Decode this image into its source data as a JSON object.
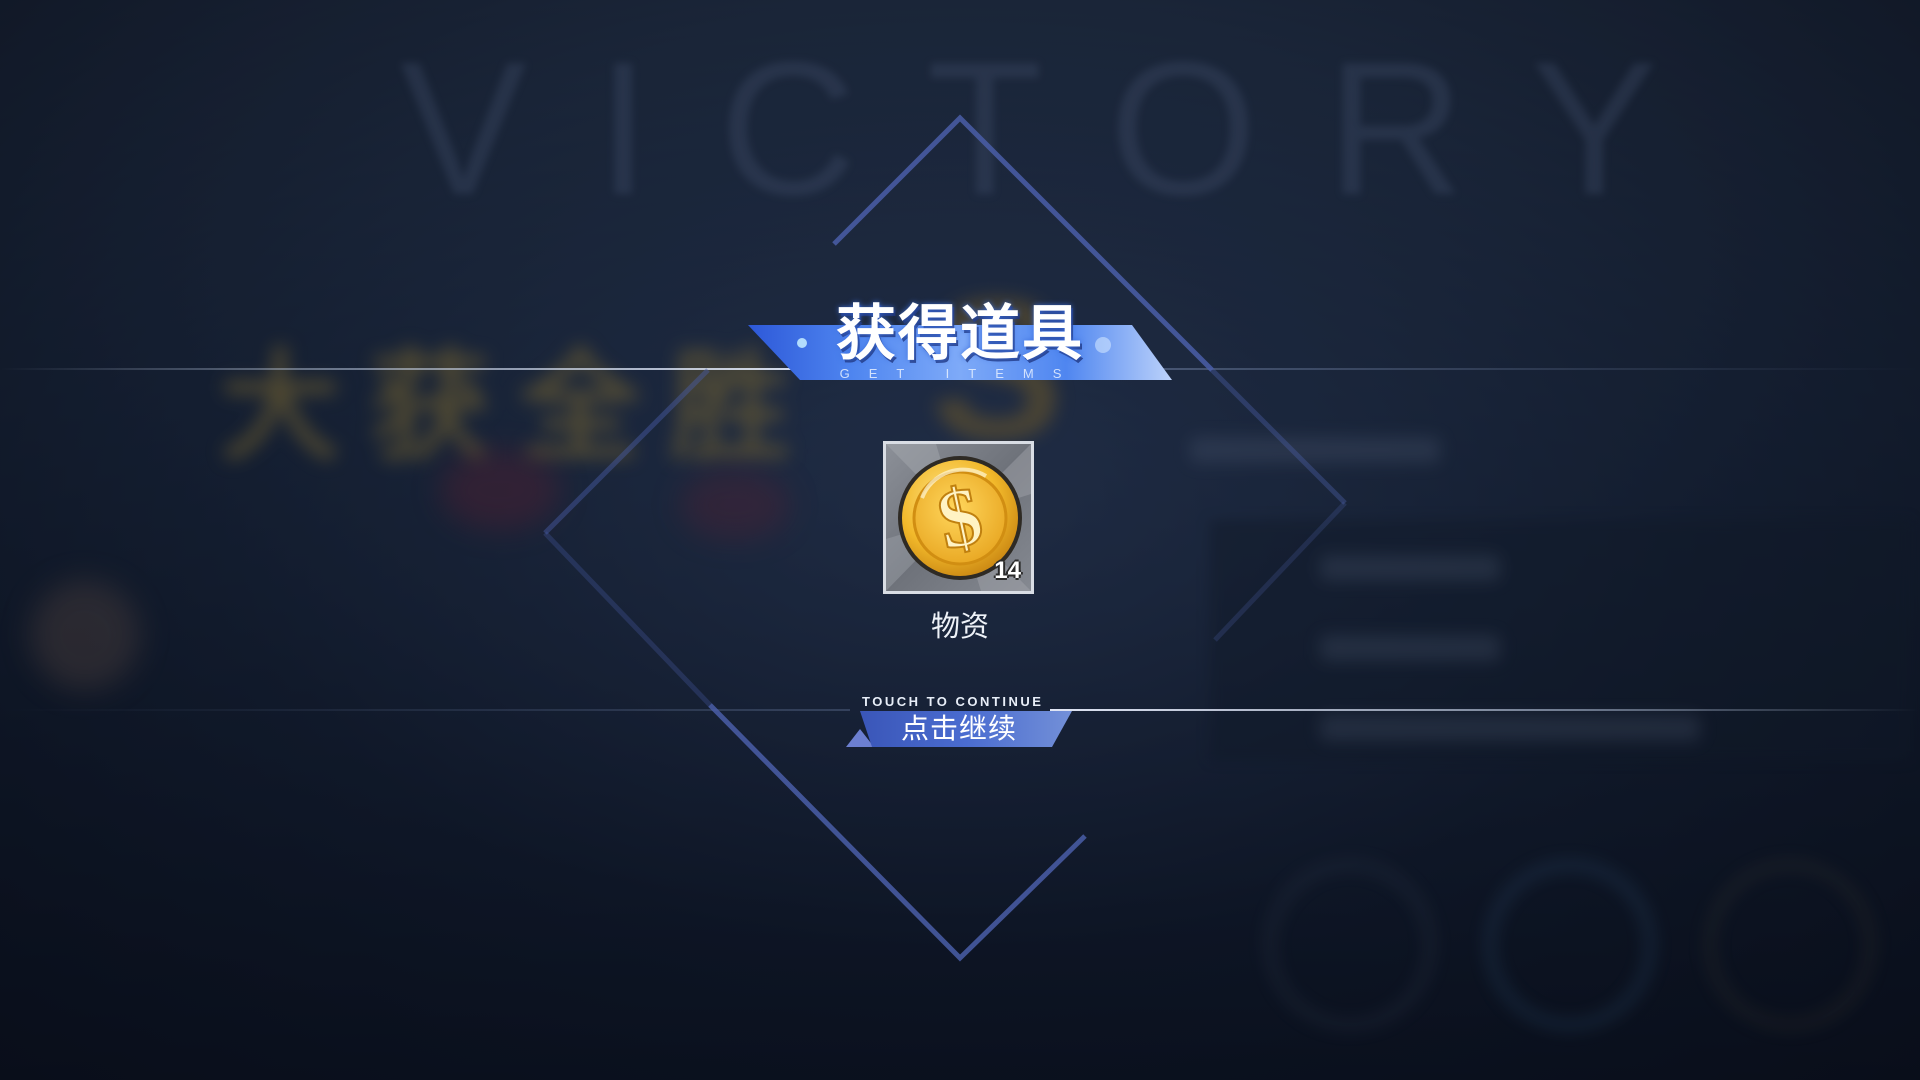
{
  "screen": {
    "background_title": "VICTORY",
    "background_banner": "大获全胜",
    "background_grade": "S"
  },
  "reward_popup": {
    "title": "获得道具",
    "subtitle": "GET ITEMS",
    "items": [
      {
        "name": "物资",
        "count": "14",
        "icon": "gold-coin-icon"
      }
    ],
    "continue_hint": "TOUCH TO CONTINUE",
    "continue_label": "点击继续"
  },
  "colors": {
    "accent_blue": "#3f6fe0",
    "frame_line": "#4a5ea8",
    "coin_gold": "#f2b92b",
    "background": "#1c2a40"
  }
}
